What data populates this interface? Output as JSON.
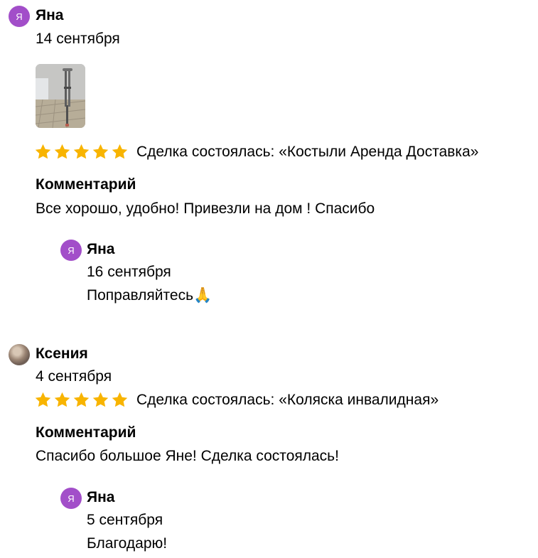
{
  "reviews": [
    {
      "author": "Яна",
      "avatar_letter": "Я",
      "date": "14 сентября",
      "rating": 5,
      "deal": "Сделка состоялась: «Костыли Аренда Доставка»",
      "comment_label": "Комментарий",
      "comment": "Все хорошо, удобно! Привезли на дом ! Спасибо",
      "reply": {
        "author": "Яна",
        "avatar_letter": "Я",
        "date": "16 сентября",
        "text": "Поправляйтесь🙏"
      }
    },
    {
      "author": "Ксения",
      "date": "4 сентября",
      "rating": 5,
      "deal": "Сделка состоялась: «Коляска инвалидная»",
      "comment_label": "Комментарий",
      "comment": "Спасибо большое Яне! Сделка состоялась!",
      "reply": {
        "author": "Яна",
        "avatar_letter": "Я",
        "date": "5 сентября",
        "text": "Благодарю!"
      }
    }
  ],
  "colors": {
    "avatar": "#a24ec9",
    "star": "#f8b400"
  }
}
